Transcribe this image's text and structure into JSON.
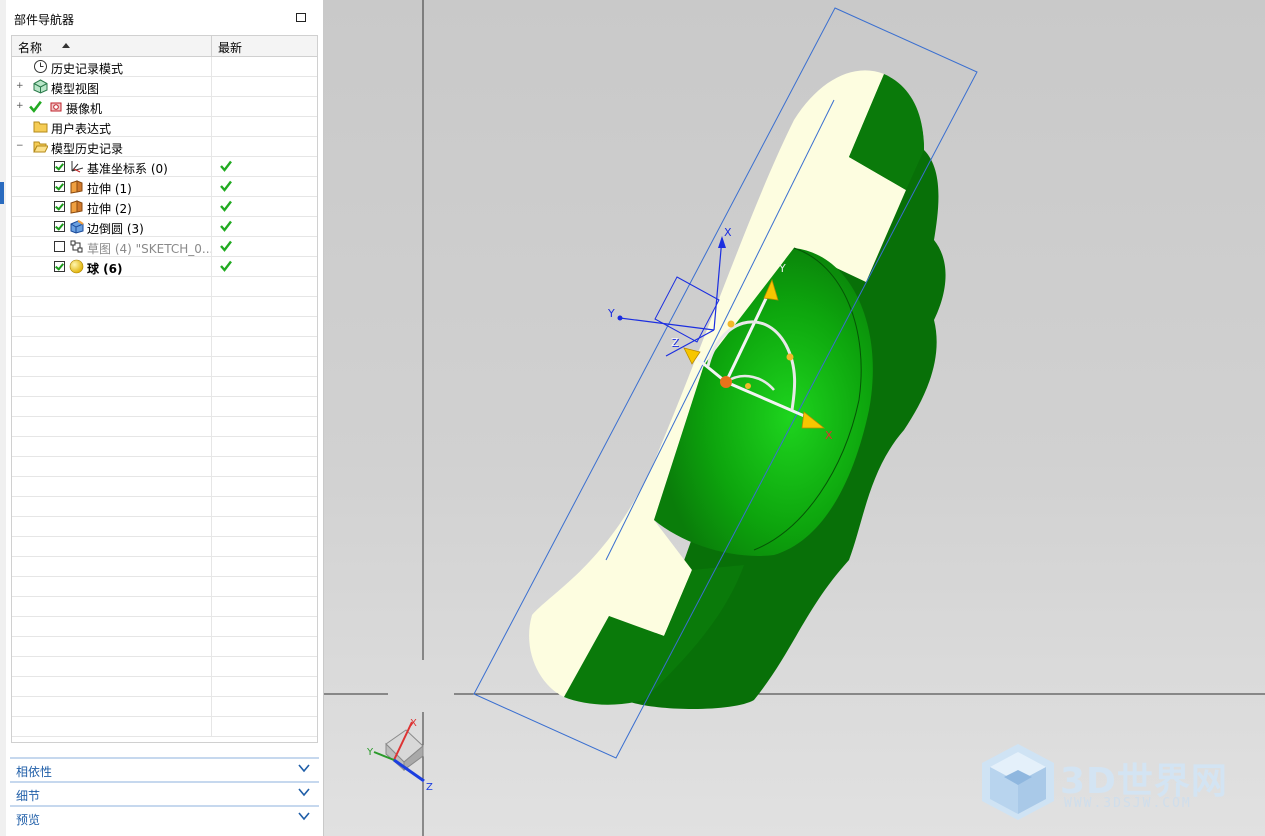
{
  "navigator": {
    "title": "部件导航器",
    "columns": {
      "name": "名称",
      "latest": "最新"
    },
    "rows": [
      {
        "label": "历史记录模式",
        "icon": "clock-icon",
        "expander": "",
        "checked": null,
        "latest": false,
        "bold": false,
        "dim": false
      },
      {
        "label": "模型视图",
        "icon": "model-view-icon",
        "expander": "+",
        "checked": null,
        "latest": false,
        "bold": false,
        "dim": false
      },
      {
        "label": "摄像机",
        "icon": "camera-icon",
        "expander": "+",
        "checked": null,
        "latest": false,
        "bold": false,
        "dim": false
      },
      {
        "label": "用户表达式",
        "icon": "folder-icon",
        "expander": "",
        "checked": null,
        "latest": false,
        "bold": false,
        "dim": false
      },
      {
        "label": "模型历史记录",
        "icon": "folder-open-icon",
        "expander": "−",
        "checked": null,
        "latest": false,
        "bold": false,
        "dim": false
      },
      {
        "label": "基准坐标系 (0)",
        "icon": "datum-csys-icon",
        "expander": "",
        "checked": true,
        "latest": true,
        "bold": false,
        "dim": false
      },
      {
        "label": "拉伸 (1)",
        "icon": "extrude-icon",
        "expander": "",
        "checked": true,
        "latest": true,
        "bold": false,
        "dim": false
      },
      {
        "label": "拉伸 (2)",
        "icon": "extrude-icon",
        "expander": "",
        "checked": true,
        "latest": true,
        "bold": false,
        "dim": false
      },
      {
        "label": "边倒圆 (3)",
        "icon": "edge-blend-icon",
        "expander": "",
        "checked": true,
        "latest": true,
        "bold": false,
        "dim": false
      },
      {
        "label": "草图 (4) \"SKETCH_0...",
        "icon": "sketch-icon",
        "expander": "",
        "checked": false,
        "latest": true,
        "bold": false,
        "dim": true
      },
      {
        "label": "球 (6)",
        "icon": "sphere-icon",
        "expander": "",
        "checked": true,
        "latest": true,
        "bold": true,
        "dim": false
      }
    ],
    "sections": [
      {
        "label": "相依性"
      },
      {
        "label": "细节"
      },
      {
        "label": "预览"
      }
    ]
  },
  "viewport": {
    "manipulator_axes": [
      "X",
      "Y",
      "Z"
    ],
    "wcs_axes": [
      "X",
      "Y",
      "Z"
    ],
    "triad_axes": [
      "X",
      "Y",
      "Z"
    ]
  },
  "watermark": {
    "title": "3D世界网",
    "url": "WWW.3DSJW.COM"
  },
  "colors": {
    "part_face": "#0a7a0a",
    "part_highlight": "#16c816",
    "part_cream": "#fdfde0",
    "selection": "#3a6fd0",
    "accent": "#1f5ea8"
  }
}
